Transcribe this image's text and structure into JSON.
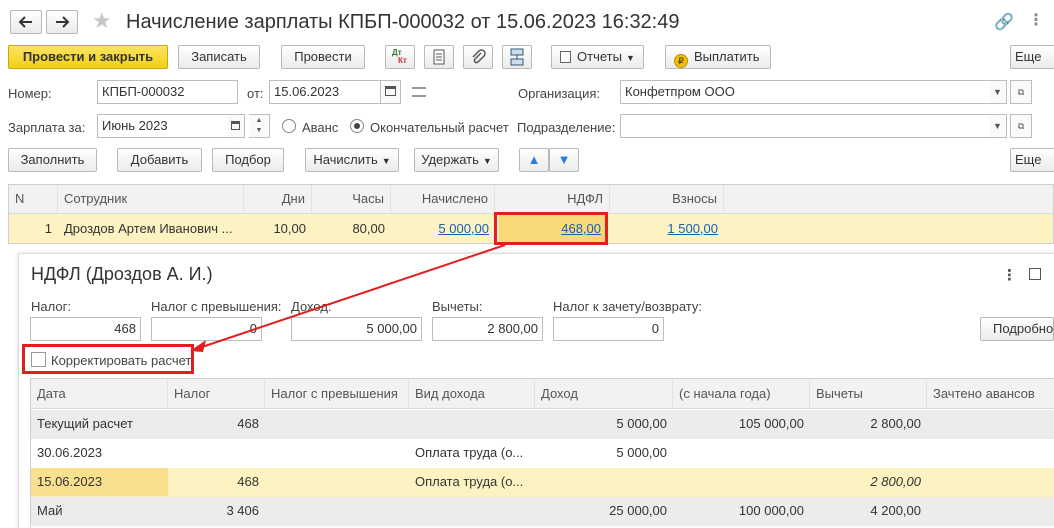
{
  "window": {
    "title": "Начисление зарплаты КПБП-000032 от 15.06.2023 16:32:49"
  },
  "toolbar": {
    "post_close": "Провести и закрыть",
    "write": "Записать",
    "post": "Провести",
    "dt_kt": "Дт Кт",
    "reports": "Отчеты",
    "pay": "Выплатить",
    "more": "Еще"
  },
  "header": {
    "number_label": "Номер:",
    "number": "КПБП-000032",
    "from_label": "от:",
    "date": "15.06.2023",
    "org_label": "Организация:",
    "org": "Конфетпром ООО",
    "salary_for_label": "Зарплата за:",
    "period": "Июнь 2023",
    "advance_label": "Аванс",
    "final_label": "Окончательный расчет",
    "division_label": "Подразделение:",
    "division": ""
  },
  "table_toolbar": {
    "fill": "Заполнить",
    "add": "Добавить",
    "select": "Подбор",
    "accrue": "Начислить",
    "withhold": "Удержать",
    "more": "Еще"
  },
  "main_table": {
    "columns": [
      "N",
      "Сотрудник",
      "Дни",
      "Часы",
      "Начислено",
      "НДФЛ",
      "Взносы"
    ],
    "rows": [
      {
        "n": "1",
        "employee": "Дроздов Артем Иванович ...",
        "days": "10,00",
        "hours": "80,00",
        "accrued": "5 000,00",
        "ndfl": "468,00",
        "contrib": "1 500,00"
      }
    ]
  },
  "panel": {
    "title": "НДФЛ (Дроздов А. И.)",
    "tax_label": "Налог:",
    "tax": "468",
    "tax_excess_label": "Налог с превышения:",
    "tax_excess": "0",
    "income_label": "Доход:",
    "income": "5 000,00",
    "deductions_label": "Вычеты:",
    "deductions": "2 800,00",
    "offset_label": "Налог к зачету/возврату:",
    "offset": "0",
    "details": "Подробно",
    "correct_label": "Корректировать расчет"
  },
  "ndfl_table": {
    "columns": [
      "Дата",
      "Налог",
      "Налог с превышения",
      "Вид дохода",
      "Доход",
      "(с начала года)",
      "Вычеты",
      "Зачтено авансов"
    ],
    "rows": [
      {
        "date": "Текущий расчет",
        "tax": "468",
        "excess": "",
        "kind": "",
        "income": "5 000,00",
        "ytd": "105 000,00",
        "deductions": "2 800,00",
        "advances": ""
      },
      {
        "date": "30.06.2023",
        "tax": "",
        "excess": "",
        "kind": "Оплата труда (о...",
        "income": "5 000,00",
        "ytd": "",
        "deductions": "",
        "advances": ""
      },
      {
        "date": "15.06.2023",
        "tax": "468",
        "excess": "",
        "kind": "Оплата труда (о...",
        "income": "",
        "ytd": "",
        "deductions": "2 800,00",
        "advances": ""
      },
      {
        "date": "Май",
        "tax": "3 406",
        "excess": "",
        "kind": "",
        "income": "25 000,00",
        "ytd": "100 000,00",
        "deductions": "4 200,00",
        "advances": ""
      }
    ]
  },
  "colors": {
    "primary_button": "#f2cf16",
    "selected_row": "#fdf3c2",
    "highlight_cell": "#f9d878",
    "annotation_red": "#e02020",
    "link": "#1a5fb4"
  }
}
